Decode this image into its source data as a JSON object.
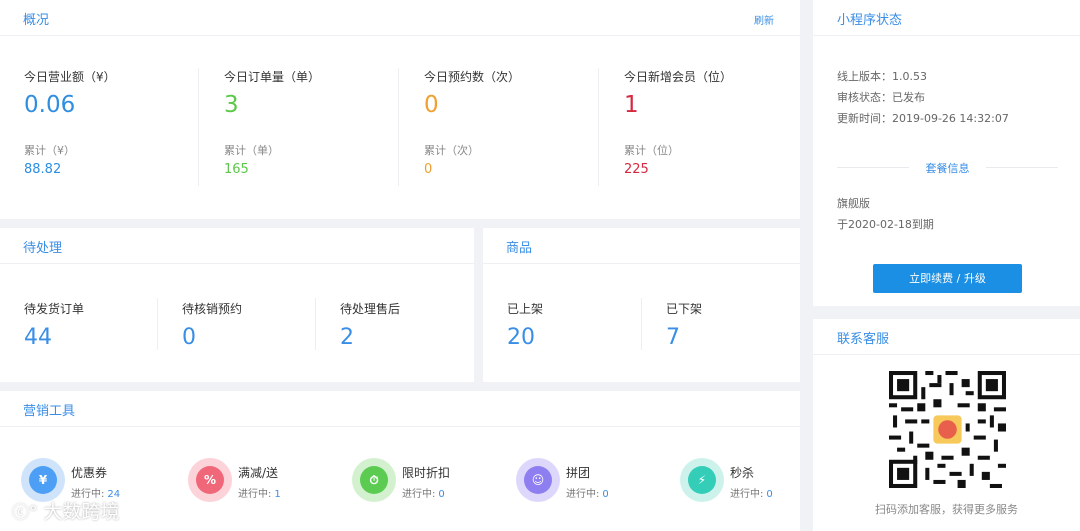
{
  "overview": {
    "title": "概况",
    "refresh": "刷新",
    "stats": [
      {
        "label": "今日营业额（¥）",
        "value": "0.06",
        "sub_label": "累计（¥）",
        "sub_value": "88.82",
        "color": "#2e8ee0"
      },
      {
        "label": "今日订单量（单）",
        "value": "3",
        "sub_label": "累计（单）",
        "sub_value": "165",
        "color": "#5bc84a"
      },
      {
        "label": "今日预约数（次）",
        "value": "0",
        "sub_label": "累计（次）",
        "sub_value": "0",
        "color": "#f0a030"
      },
      {
        "label": "今日新增会员（位）",
        "value": "1",
        "sub_label": "累计（位）",
        "sub_value": "225",
        "color": "#d6283e"
      }
    ]
  },
  "pending": {
    "title": "待处理",
    "items": [
      {
        "label": "待发货订单",
        "value": "44"
      },
      {
        "label": "待核销预约",
        "value": "0"
      },
      {
        "label": "待处理售后",
        "value": "2"
      }
    ]
  },
  "goods": {
    "title": "商品",
    "items": [
      {
        "label": "已上架",
        "value": "20"
      },
      {
        "label": "已下架",
        "value": "7"
      }
    ]
  },
  "marketing": {
    "title": "营销工具",
    "status_prefix": "进行中:",
    "tools": [
      {
        "name": "优惠券",
        "count": "24",
        "icon": "coupon-icon",
        "glyph": "¥",
        "color": "#4d9ef5",
        "ring": "#cfe3fb"
      },
      {
        "name": "满减/送",
        "count": "1",
        "icon": "discount-icon",
        "glyph": "%",
        "color": "#f0677a",
        "ring": "#fbd3d9"
      },
      {
        "name": "限时折扣",
        "count": "0",
        "icon": "flash-sale-icon",
        "glyph": "⏱",
        "color": "#5ccb52",
        "ring": "#d3f1cf"
      },
      {
        "name": "拼团",
        "count": "0",
        "icon": "group-buy-icon",
        "glyph": "☺",
        "color": "#8e7ff0",
        "ring": "#ddd8fb"
      },
      {
        "name": "秒杀",
        "count": "0",
        "icon": "seckill-icon",
        "glyph": "⚡",
        "color": "#33cdb8",
        "ring": "#cdf2ec"
      }
    ]
  },
  "miniapp": {
    "title": "小程序状态",
    "version": "线上版本：1.0.53",
    "audit": "审核状态：已发布",
    "updated": "更新时间：2019-09-26 14:32:07",
    "plan_title": "套餐信息",
    "plan_name": "旗舰版",
    "expire": "于2020-02-18到期",
    "renew_button": "立即续费 / 升级"
  },
  "support": {
    "title": "联系客服",
    "caption": "扫码添加客服，获得更多服务"
  },
  "watermark": "大数跨境"
}
